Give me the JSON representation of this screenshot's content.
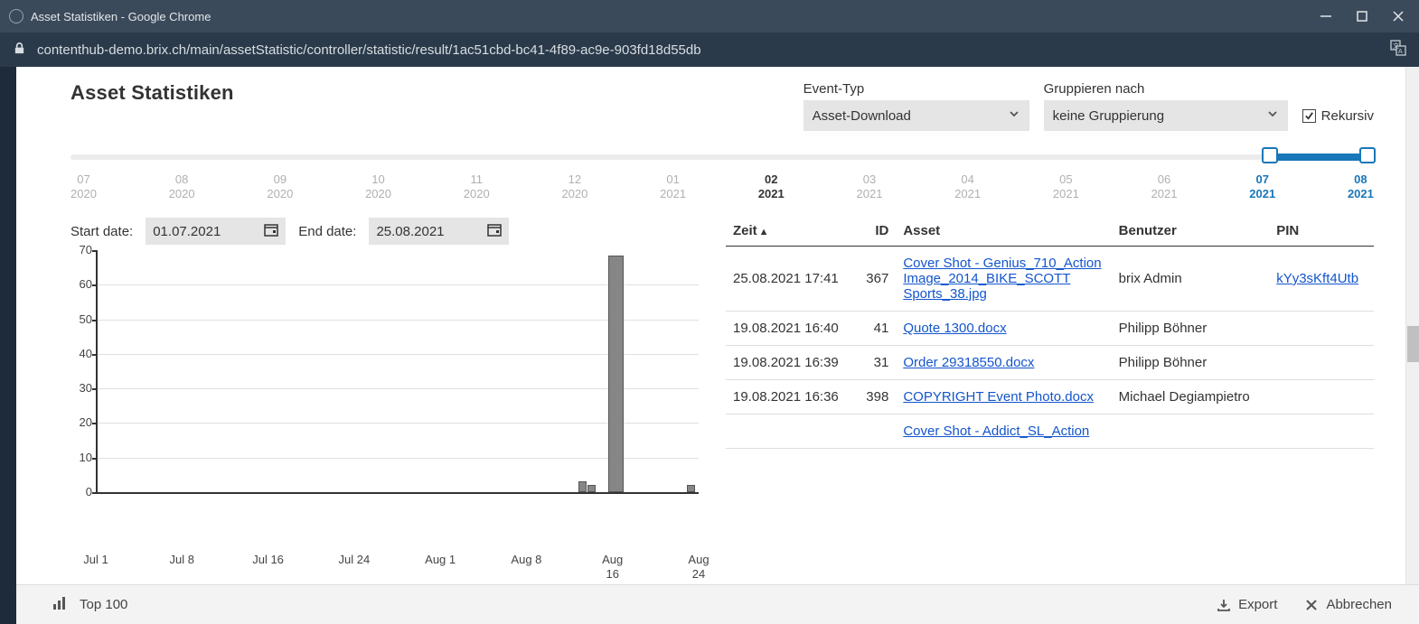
{
  "window": {
    "title": "Asset Statistiken - Google Chrome",
    "url": "contenthub-demo.brix.ch/main/assetStatistic/controller/statistic/result/1ac51cbd-bc41-4f89-ac9e-903fd18d55db"
  },
  "page": {
    "title": "Asset Statistiken"
  },
  "controls": {
    "event_type": {
      "label": "Event-Typ",
      "value": "Asset-Download"
    },
    "group_by": {
      "label": "Gruppieren nach",
      "value": "keine Gruppierung"
    },
    "recursive": {
      "label": "Rekursiv",
      "checked": true
    }
  },
  "timeline": {
    "labels": [
      {
        "m": "07",
        "y": "2020",
        "state": "normal"
      },
      {
        "m": "08",
        "y": "2020",
        "state": "normal"
      },
      {
        "m": "09",
        "y": "2020",
        "state": "normal"
      },
      {
        "m": "10",
        "y": "2020",
        "state": "normal"
      },
      {
        "m": "11",
        "y": "2020",
        "state": "normal"
      },
      {
        "m": "12",
        "y": "2020",
        "state": "normal"
      },
      {
        "m": "01",
        "y": "2021",
        "state": "normal"
      },
      {
        "m": "02",
        "y": "2021",
        "state": "bold"
      },
      {
        "m": "03",
        "y": "2021",
        "state": "normal"
      },
      {
        "m": "04",
        "y": "2021",
        "state": "normal"
      },
      {
        "m": "05",
        "y": "2021",
        "state": "normal"
      },
      {
        "m": "06",
        "y": "2021",
        "state": "normal"
      },
      {
        "m": "07",
        "y": "2021",
        "state": "active"
      },
      {
        "m": "08",
        "y": "2021",
        "state": "active"
      }
    ],
    "range_start_pct": 92,
    "range_end_pct": 99.5
  },
  "dates": {
    "start_label": "Start date:",
    "start_value": "01.07.2021",
    "end_label": "End date:",
    "end_value": "25.08.2021"
  },
  "chart_data": {
    "type": "bar",
    "ylim": [
      0,
      70
    ],
    "yticks": [
      0,
      10,
      20,
      30,
      40,
      50,
      60,
      70
    ],
    "xticks": [
      "Jul 1",
      "Jul 8",
      "Jul 16",
      "Jul 24",
      "Aug 1",
      "Aug 8",
      "Aug 16",
      "Aug 24"
    ],
    "bars": [
      {
        "x_pct": 80,
        "width_pct": 1.4,
        "value": 3
      },
      {
        "x_pct": 81.5,
        "width_pct": 1.4,
        "value": 2
      },
      {
        "x_pct": 85,
        "width_pct": 2.5,
        "value": 68
      },
      {
        "x_pct": 98,
        "width_pct": 1.4,
        "value": 2
      }
    ]
  },
  "table": {
    "columns": {
      "time": "Zeit",
      "id": "ID",
      "asset": "Asset",
      "user": "Benutzer",
      "pin": "PIN"
    },
    "rows": [
      {
        "time": "25.08.2021 17:41",
        "id": "367",
        "asset": "Cover Shot - Genius_710_Action Image_2014_BIKE_SCOTT Sports_38.jpg",
        "user": "brix Admin",
        "pin": "kYy3sKft4Utb"
      },
      {
        "time": "19.08.2021 16:40",
        "id": "41",
        "asset": "Quote 1300.docx",
        "user": "Philipp Böhner",
        "pin": ""
      },
      {
        "time": "19.08.2021 16:39",
        "id": "31",
        "asset": "Order 29318550.docx",
        "user": "Philipp Böhner",
        "pin": ""
      },
      {
        "time": "19.08.2021 16:36",
        "id": "398",
        "asset": "COPYRIGHT Event Photo.docx",
        "user": "Michael Degiampietro",
        "pin": ""
      },
      {
        "time": "",
        "id": "",
        "asset": "Cover Shot - Addict_SL_Action",
        "user": "",
        "pin": ""
      }
    ]
  },
  "footer": {
    "top100": "Top 100",
    "export": "Export",
    "cancel": "Abbrechen"
  }
}
